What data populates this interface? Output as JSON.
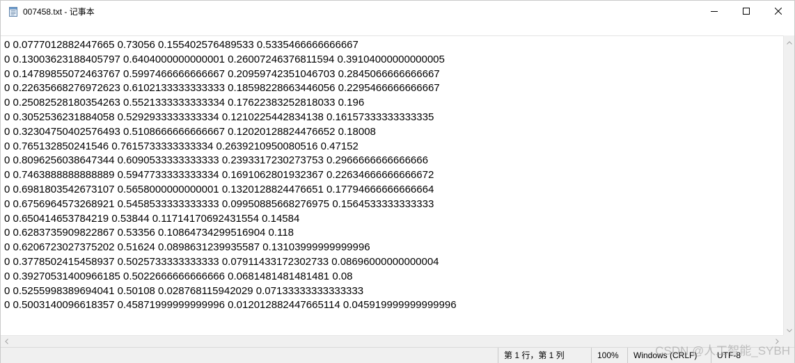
{
  "window": {
    "title": "007458.txt - 记事本"
  },
  "menu": [],
  "editor": {
    "lines": [
      "0 0.0777012882447665 0.73056 0.155402576489533 0.5335466666666667",
      "0 0.13003623188405797 0.6404000000000001 0.26007246376811594 0.39104000000000005",
      "0 0.14789855072463767 0.5997466666666667 0.20959742351046703 0.2845066666666667",
      "0 0.22635668276972623 0.6102133333333333 0.18598228663446056 0.2295466666666667",
      "0 0.25082528180354263 0.5521333333333334 0.17622383252818033 0.196",
      "0 0.3052536231884058 0.5292933333333334 0.1210225442834138 0.16157333333333335",
      "0 0.32304750402576493 0.5108666666666667 0.12020128824476652 0.18008",
      "0 0.765132850241546 0.7615733333333334 0.2639210950080516 0.47152",
      "0 0.8096256038647344 0.6090533333333333 0.2393317230273753 0.2966666666666666",
      "0 0.7463888888888889 0.5947733333333334 0.1691062801932367 0.22634666666666672",
      "0 0.6981803542673107 0.5658000000000001 0.1320128824476651 0.17794666666666664",
      "0 0.6756964573268921 0.5458533333333333 0.09950885668276975 0.1564533333333333",
      "0 0.650414653784219 0.53844 0.11714170692431554 0.14584",
      "0 0.6283735909822867 0.53356 0.10864734299516904 0.118",
      "0 0.6206723027375202 0.51624 0.0898631239935587 0.13103999999999996",
      "0 0.3778502415458937 0.5025733333333333 0.07911433172302733 0.08696000000000004",
      "0 0.39270531400966185 0.5022666666666666 0.0681481481481481 0.08",
      "0 0.5255998389694041 0.50108 0.028768115942029 0.07133333333333333",
      "0 0.5003140096618357 0.45871999999999996 0.012012882447665114 0.045919999999999996"
    ]
  },
  "status": {
    "position": "第 1 行，第 1 列",
    "zoom": "100%",
    "line_ending": "Windows (CRLF)",
    "encoding": "UTF-8"
  },
  "watermark": "CSDN @人工智能_SYBH",
  "icons": {
    "app": "notepad-icon",
    "minimize": "minimize-icon",
    "maximize": "maximize-icon",
    "close": "close-icon"
  }
}
